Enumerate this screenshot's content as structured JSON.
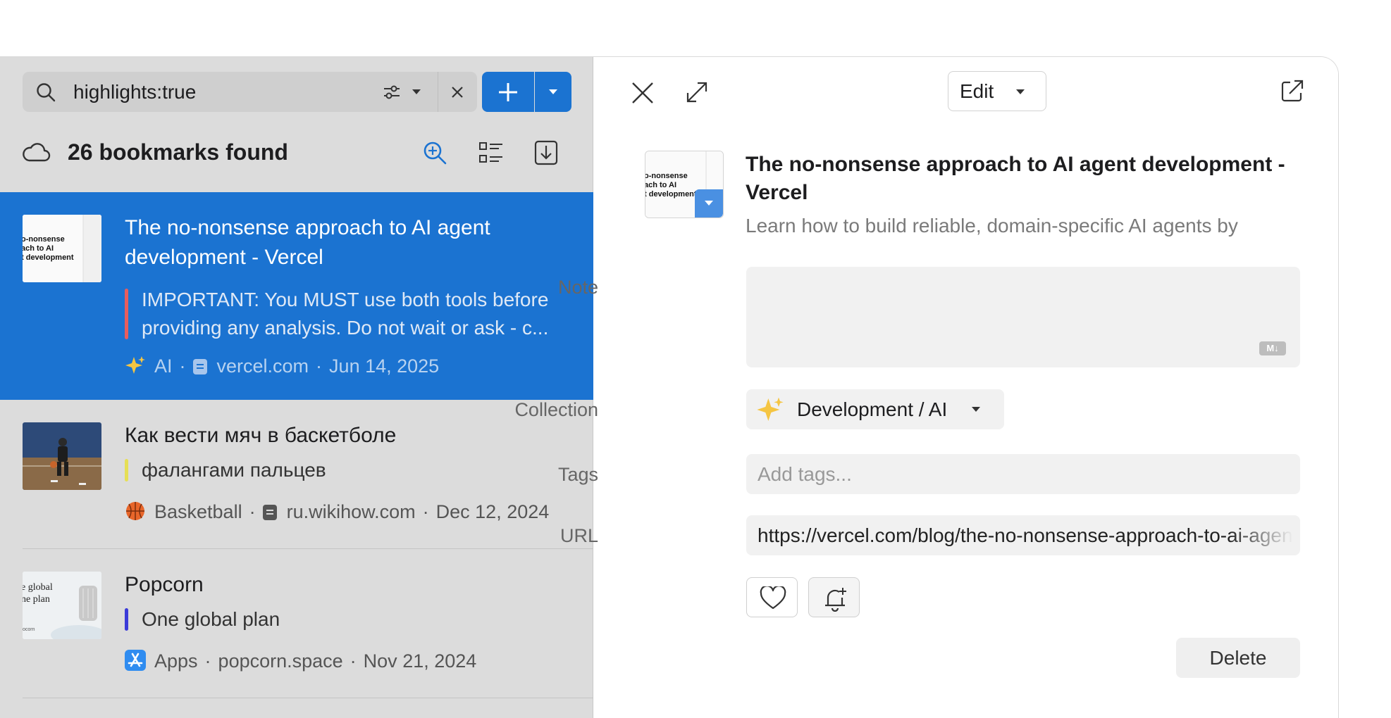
{
  "search": {
    "query": "highlights:true"
  },
  "list": {
    "count_label": "26 bookmarks found",
    "items": [
      {
        "title": "The no-nonsense approach to AI agent development - Vercel",
        "highlight": "IMPORTANT: You MUST use both tools before providing any analysis. Do not wait or ask - c...",
        "highlight_color": "#e85d5d",
        "collection": "AI",
        "domain": "vercel.com",
        "date": "Jun 14, 2025",
        "thumb_text": "o-nonsense ach to AI t development"
      },
      {
        "title": "Как вести мяч в баскетболе",
        "highlight": "фалангами пальцев",
        "highlight_color": "#e6df55",
        "collection": "Basketball",
        "domain": "ru.wikihow.com",
        "date": "Dec 12, 2024"
      },
      {
        "title": "Popcorn",
        "highlight": "One global plan",
        "highlight_color": "#3b3bd8",
        "collection": "Apps",
        "domain": "popcorn.space",
        "date": "Nov 21, 2024",
        "thumb_text": "e global ne plan"
      }
    ]
  },
  "detail": {
    "edit_label": "Edit",
    "title": "The no-nonsense approach to AI agent development - Vercel",
    "description": "Learn how to build reliable, domain-specific AI agents by",
    "thumb_text": "o-nonsense ach to AI t development",
    "labels": {
      "note": "Note",
      "collection": "Collection",
      "tags": "Tags",
      "url": "URL"
    },
    "markdown_badge": "M↓",
    "collection": "Development / AI",
    "tags_placeholder": "Add tags...",
    "url": "https://vercel.com/blog/the-no-nonsense-approach-to-ai-agent-development",
    "delete_label": "Delete"
  },
  "colors": {
    "accent": "#1b73d1",
    "left_bg": "#dcdcdc"
  },
  "icons": [
    "search-icon",
    "filter-icon",
    "close-icon",
    "plus-icon",
    "cloud-icon",
    "search-zoom-icon",
    "list-view-icon",
    "export-icon",
    "expand-icon",
    "external-link-icon",
    "heart-icon",
    "reminder-bell-icon",
    "sparkles-icon",
    "basketball-icon",
    "app-store-icon"
  ]
}
